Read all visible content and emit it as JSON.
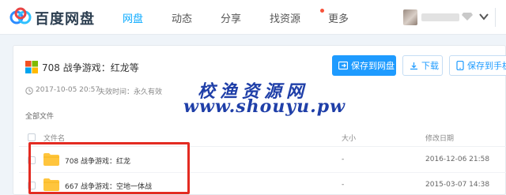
{
  "header": {
    "brand": "百度网盘",
    "nav": [
      {
        "label": "网盘",
        "active": true
      },
      {
        "label": "动态",
        "active": false
      },
      {
        "label": "分享",
        "active": false
      },
      {
        "label": "找资源",
        "active": false,
        "badge_dot": true
      },
      {
        "label": "更多",
        "active": false
      }
    ]
  },
  "share": {
    "title": "708 战争游戏：红龙等",
    "date": "2017-10-05 20:57",
    "expiry": "失效时间：永久有效",
    "buttons": {
      "save": "保存到网盘",
      "download": "下载",
      "phone": "保存到手机"
    }
  },
  "breadcrumb": "全部文件",
  "table": {
    "headers": {
      "name": "文件名",
      "size": "大小",
      "date": "修改日期"
    },
    "rows": [
      {
        "name": "708 战争游戏：红龙",
        "size": "-",
        "date": "2016-12-06 21:58"
      },
      {
        "name": "667 战争游戏：空地一体战",
        "size": "-",
        "date": "2015-03-07 14:38"
      }
    ]
  },
  "watermark": {
    "line1": "校渔资源网",
    "line2": "www.shouyu.pw"
  },
  "colors": {
    "accent": "#09aaff",
    "primary_button": "#1e9bff",
    "highlight": "#e32b22",
    "watermark": "#1f3fa8",
    "folder": "#ffc53d"
  }
}
